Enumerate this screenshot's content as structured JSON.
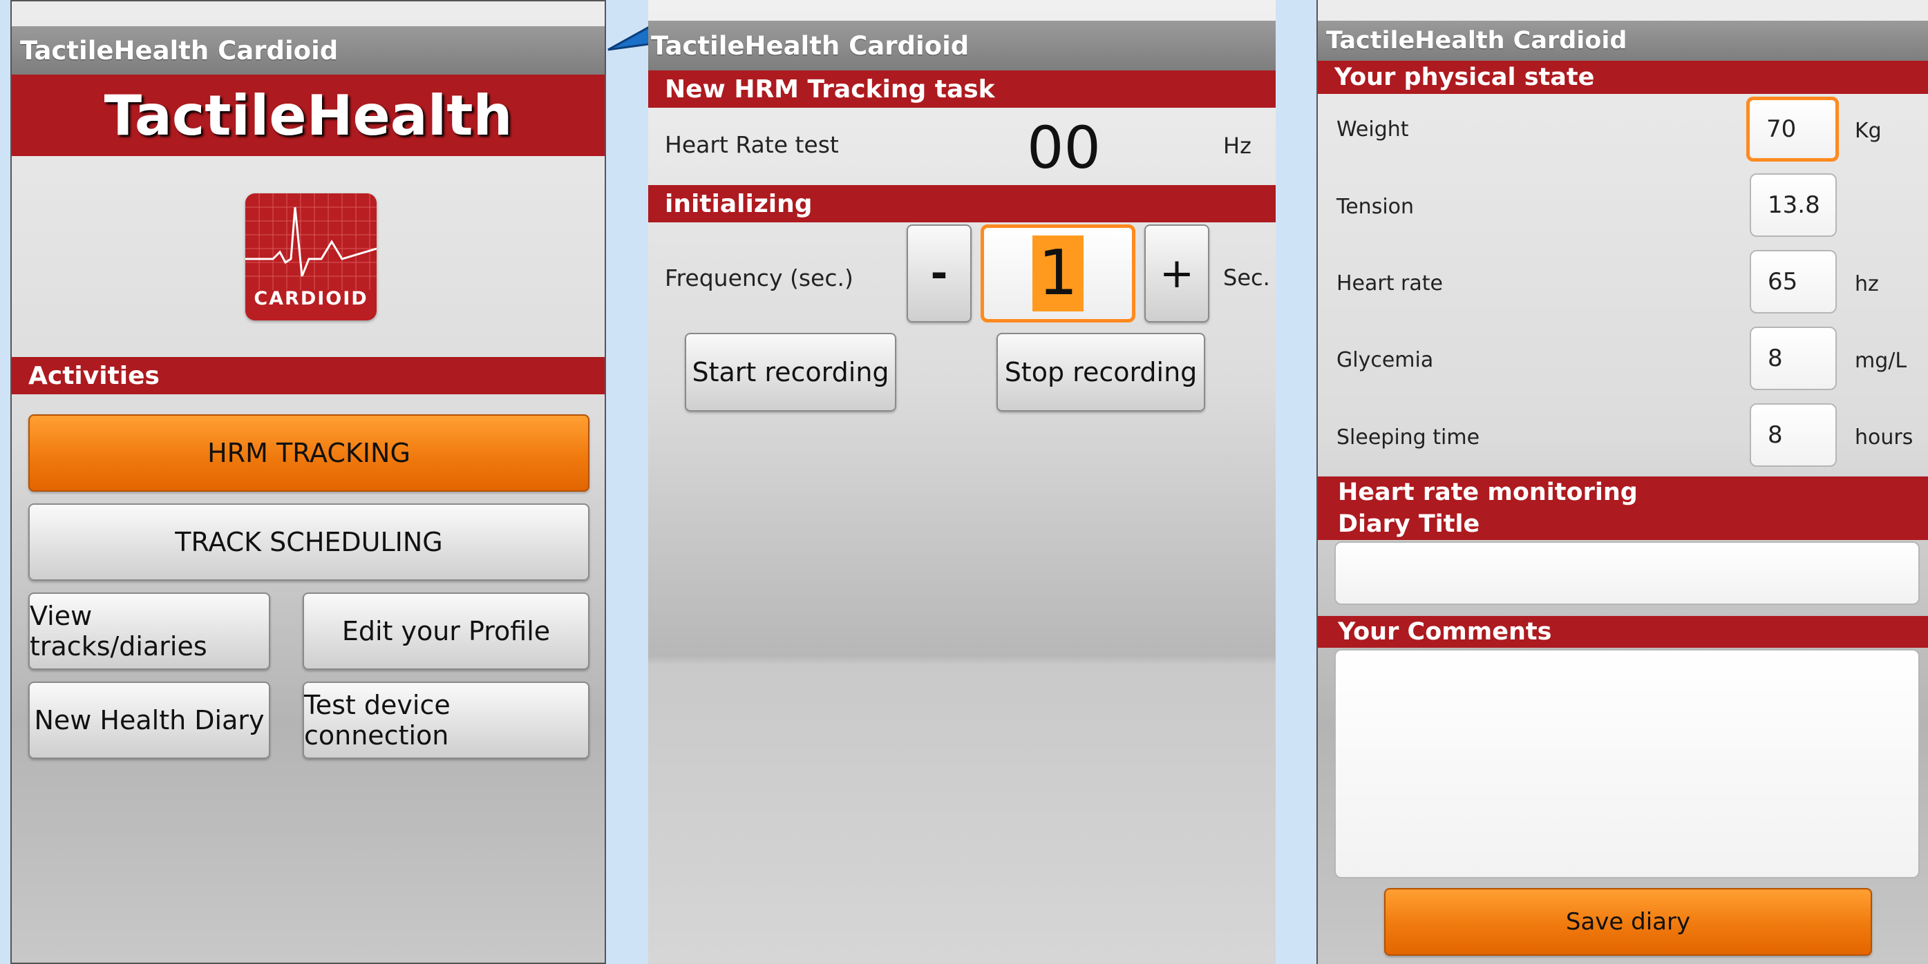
{
  "colors": {
    "accent_red": "#ad1a1f",
    "accent_orange": "#f07a0e",
    "background": "#cfe3f6"
  },
  "screen1": {
    "title": "TactileHealth Cardioid",
    "brand": "TactileHealth",
    "logo_text": "CARDIOID",
    "logo_icon": "heartbeat-ecg-icon",
    "activities_header": "Activities",
    "buttons": {
      "hrm_tracking": "HRM TRACKING",
      "track_scheduling": "TRACK SCHEDULING",
      "view_tracks": "View tracks/diaries",
      "edit_profile": "Edit your Profile",
      "new_diary": "New Health Diary",
      "test_device": "Test device connection"
    }
  },
  "screen2": {
    "title": "TactileHealth Cardioid",
    "task_header": "New HRM Tracking task",
    "heart_rate_label": "Heart Rate test",
    "heart_rate_value": "00",
    "heart_rate_unit": "Hz",
    "status_header": "initializing",
    "frequency_label": "Frequency (sec.)",
    "minus_label": "-",
    "frequency_value": "1",
    "plus_label": "+",
    "frequency_unit": "Sec.",
    "start_label": "Start recording",
    "stop_label": "Stop recording"
  },
  "screen3": {
    "title": "TactileHealth Cardioid",
    "physical_header": "Your physical state",
    "fields": [
      {
        "label": "Weight",
        "value": "70",
        "unit": "Kg"
      },
      {
        "label": "Tension",
        "value": "13.8",
        "unit": ""
      },
      {
        "label": "Heart rate",
        "value": "65",
        "unit": "hz"
      },
      {
        "label": "Glycemia",
        "value": "8",
        "unit": "mg/L"
      },
      {
        "label": "Sleeping time",
        "value": "8",
        "unit": "hours"
      }
    ],
    "monitoring_header": "Heart rate monitoring",
    "diary_title_header": "Diary Title",
    "diary_title_value": "",
    "comments_header": "Your Comments",
    "comments_value": "",
    "save_label": "Save diary"
  }
}
